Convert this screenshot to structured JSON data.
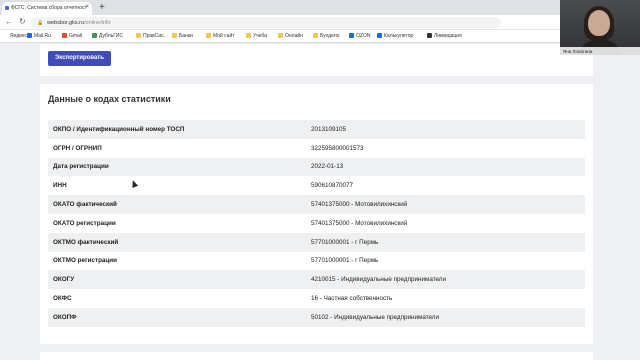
{
  "browser": {
    "tab_title": "ФСГС: Система сбора отчетност",
    "tab_close": "×",
    "new_tab": "+",
    "url_domain": "websbor.gks.ru",
    "url_path": "/online/info",
    "bookmarks": [
      {
        "label": "Яндекс",
        "icon": "yandex-icon"
      },
      {
        "label": "Mail.Ru",
        "icon": "mail-icon"
      },
      {
        "label": "Gmail",
        "icon": "gmail-icon"
      },
      {
        "label": "ДубльГИС",
        "icon": "2gis-icon"
      },
      {
        "label": "ПравСис.",
        "icon": "folder-icon"
      },
      {
        "label": "Банки",
        "icon": "folder-icon"
      },
      {
        "label": "Мой сайт",
        "icon": "folder-icon"
      },
      {
        "label": "Учеба",
        "icon": "folder-icon"
      },
      {
        "label": "Онлайн",
        "icon": "folder-icon"
      },
      {
        "label": "Бухдело",
        "icon": "folder-icon"
      },
      {
        "label": "OZON",
        "icon": "ozon-icon"
      },
      {
        "label": "Калькулятор",
        "icon": "calculator-icon"
      },
      {
        "label": "Ликвидация",
        "icon": "liquidation-icon"
      }
    ]
  },
  "webcam": {
    "name": "Яна Лопатина"
  },
  "toolbar": {
    "export_label": "Экспортировать"
  },
  "stats": {
    "title": "Данные о кодах статистики",
    "rows": [
      {
        "key": "ОКПО / Идентификационный номер ТОСП",
        "value": "2013109105"
      },
      {
        "key": "ОГРН / ОГРНИП",
        "value": "322595800001573"
      },
      {
        "key": "Дата регистрации",
        "value": "2022-01-13"
      },
      {
        "key": "ИНН",
        "value": "590610870077"
      },
      {
        "key": "ОКАТО фактический",
        "value": "57401375000 - Мотовилихинский"
      },
      {
        "key": "ОКАТО регистрации",
        "value": "57401375000 - Мотовилихинский"
      },
      {
        "key": "ОКТМО фактический",
        "value": "57701000001 - г Пермь"
      },
      {
        "key": "ОКТМО регистрации",
        "value": "57701000001 - г Пермь"
      },
      {
        "key": "ОКОГУ",
        "value": "4210015 - Индивидуальные предприниматели"
      },
      {
        "key": "ОКФС",
        "value": "16 - Частная собственность"
      },
      {
        "key": "ОКОПФ",
        "value": "50102 - Индивидуальные предприниматели"
      }
    ]
  }
}
